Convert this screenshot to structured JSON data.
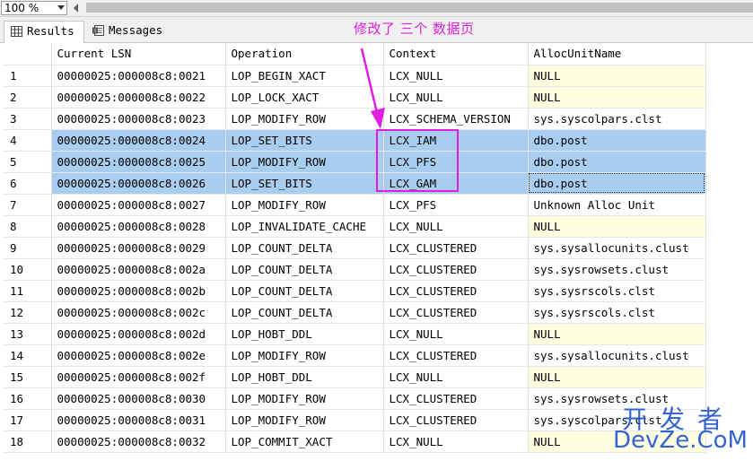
{
  "toolbar": {
    "zoom": "100 %"
  },
  "tabs": {
    "results": "Results",
    "messages": "Messages"
  },
  "annotation": {
    "text": "修改了 三个 数据页"
  },
  "columns": [
    "Current LSN",
    "Operation",
    "Context",
    "AllocUnitName"
  ],
  "rows": [
    {
      "n": "1",
      "lsn": "00000025:000008c8:0021",
      "op": "LOP_BEGIN_XACT",
      "ctx": "LCX_NULL",
      "alloc": "NULL"
    },
    {
      "n": "2",
      "lsn": "00000025:000008c8:0022",
      "op": "LOP_LOCK_XACT",
      "ctx": "LCX_NULL",
      "alloc": "NULL"
    },
    {
      "n": "3",
      "lsn": "00000025:000008c8:0023",
      "op": "LOP_MODIFY_ROW",
      "ctx": "LCX_SCHEMA_VERSION",
      "alloc": "sys.syscolpars.clst"
    },
    {
      "n": "4",
      "lsn": "00000025:000008c8:0024",
      "op": "LOP_SET_BITS",
      "ctx": "LCX_IAM",
      "alloc": "dbo.post"
    },
    {
      "n": "5",
      "lsn": "00000025:000008c8:0025",
      "op": "LOP_MODIFY_ROW",
      "ctx": "LCX_PFS",
      "alloc": "dbo.post"
    },
    {
      "n": "6",
      "lsn": "00000025:000008c8:0026",
      "op": "LOP_SET_BITS",
      "ctx": "LCX_GAM",
      "alloc": "dbo.post"
    },
    {
      "n": "7",
      "lsn": "00000025:000008c8:0027",
      "op": "LOP_MODIFY_ROW",
      "ctx": "LCX_PFS",
      "alloc": "Unknown Alloc Unit"
    },
    {
      "n": "8",
      "lsn": "00000025:000008c8:0028",
      "op": "LOP_INVALIDATE_CACHE",
      "ctx": "LCX_NULL",
      "alloc": "NULL"
    },
    {
      "n": "9",
      "lsn": "00000025:000008c8:0029",
      "op": "LOP_COUNT_DELTA",
      "ctx": "LCX_CLUSTERED",
      "alloc": "sys.sysallocunits.clust"
    },
    {
      "n": "10",
      "lsn": "00000025:000008c8:002a",
      "op": "LOP_COUNT_DELTA",
      "ctx": "LCX_CLUSTERED",
      "alloc": "sys.sysrowsets.clust"
    },
    {
      "n": "11",
      "lsn": "00000025:000008c8:002b",
      "op": "LOP_COUNT_DELTA",
      "ctx": "LCX_CLUSTERED",
      "alloc": "sys.sysrscols.clst"
    },
    {
      "n": "12",
      "lsn": "00000025:000008c8:002c",
      "op": "LOP_COUNT_DELTA",
      "ctx": "LCX_CLUSTERED",
      "alloc": "sys.sysrscols.clst"
    },
    {
      "n": "13",
      "lsn": "00000025:000008c8:002d",
      "op": "LOP_HOBT_DDL",
      "ctx": "LCX_NULL",
      "alloc": "NULL"
    },
    {
      "n": "14",
      "lsn": "00000025:000008c8:002e",
      "op": "LOP_MODIFY_ROW",
      "ctx": "LCX_CLUSTERED",
      "alloc": "sys.sysallocunits.clust"
    },
    {
      "n": "15",
      "lsn": "00000025:000008c8:002f",
      "op": "LOP_HOBT_DDL",
      "ctx": "LCX_NULL",
      "alloc": "NULL"
    },
    {
      "n": "16",
      "lsn": "00000025:000008c8:0030",
      "op": "LOP_MODIFY_ROW",
      "ctx": "LCX_CLUSTERED",
      "alloc": "sys.sysrowsets.clust"
    },
    {
      "n": "17",
      "lsn": "00000025:000008c8:0031",
      "op": "LOP_MODIFY_ROW",
      "ctx": "LCX_CLUSTERED",
      "alloc": "sys.syscolpars.clst"
    },
    {
      "n": "18",
      "lsn": "00000025:000008c8:0032",
      "op": "LOP_COMMIT_XACT",
      "ctx": "LCX_NULL",
      "alloc": "NULL"
    }
  ],
  "selected_rows": [
    "4",
    "5",
    "6"
  ],
  "colors": {
    "selection": "#a9cdef",
    "null_cell": "#fffee0",
    "annotation": "#e020e0",
    "watermark": "#1a4fd0"
  },
  "watermark": {
    "top": "开发者",
    "bottom": "DevZe.CoM"
  }
}
